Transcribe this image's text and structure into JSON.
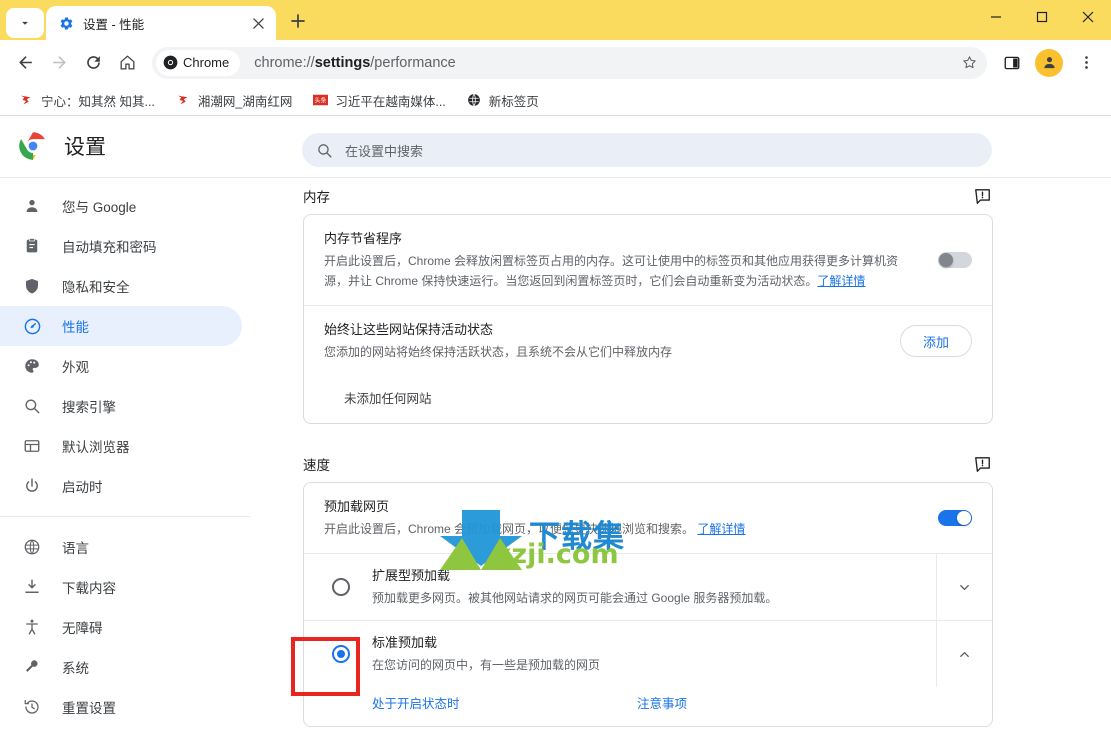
{
  "window": {
    "minimize_label": "—",
    "maximize_label": "□",
    "close_label": "✕"
  },
  "tabstrip": {
    "tab_search_icon": "chevron-down-icon",
    "tabs": [
      {
        "title": "设置 - 性能",
        "favicon": "gear-icon",
        "close_label": "✕"
      }
    ],
    "new_tab_label": "+"
  },
  "toolbar": {
    "back_icon": "back-arrow-icon",
    "forward_icon": "forward-arrow-icon",
    "reload_icon": "reload-icon",
    "home_icon": "home-icon",
    "chrome_chip_label": "Chrome",
    "url_prefix": "chrome://",
    "url_bold": "settings",
    "url_suffix": "/performance",
    "bookmark_icon": "star-icon",
    "sidepanel_icon": "side-panel-icon",
    "profile_icon": "avatar-icon",
    "menu_icon": "three-dot-menu-icon"
  },
  "bookmarks": [
    {
      "label": "宁心：知其然 知其...",
      "icon": "site-favicon-red"
    },
    {
      "label": "湘潮网_湖南红网",
      "icon": "site-favicon-red"
    },
    {
      "label": "习近平在越南媒体...",
      "icon": "toutiao-favicon"
    },
    {
      "label": "新标签页",
      "icon": "globe-dark-icon"
    }
  ],
  "settings_header": {
    "logo_icon": "chrome-logo-icon",
    "title": "设置",
    "search": {
      "icon": "search-icon",
      "placeholder": "在设置中搜索",
      "value": ""
    }
  },
  "sidebar": {
    "items": [
      {
        "label": "您与 Google",
        "icon": "person-icon",
        "active": false
      },
      {
        "label": "自动填充和密码",
        "icon": "clipboard-icon",
        "active": false
      },
      {
        "label": "隐私和安全",
        "icon": "shield-icon",
        "active": false
      },
      {
        "label": "性能",
        "icon": "speedometer-icon",
        "active": true
      },
      {
        "label": "外观",
        "icon": "palette-icon",
        "active": false
      },
      {
        "label": "搜索引擎",
        "icon": "search-icon",
        "active": false
      },
      {
        "label": "默认浏览器",
        "icon": "browser-window-icon",
        "active": false
      },
      {
        "label": "启动时",
        "icon": "power-icon",
        "active": false
      }
    ],
    "items2": [
      {
        "label": "语言",
        "icon": "globe-icon",
        "active": false
      },
      {
        "label": "下载内容",
        "icon": "download-icon",
        "active": false
      },
      {
        "label": "无障碍",
        "icon": "accessibility-icon",
        "active": false
      },
      {
        "label": "系统",
        "icon": "wrench-icon",
        "active": false
      },
      {
        "label": "重置设置",
        "icon": "history-restore-icon",
        "active": false
      }
    ]
  },
  "main": {
    "memory": {
      "section_title": "内存",
      "feedback_icon": "feedback-icon",
      "memory_saver": {
        "title": "内存节省程序",
        "description": "开启此设置后，Chrome 会释放闲置标签页占用的内存。这可让使用中的标签页和其他应用获得更多计算机资源，并让 Chrome 保持快速运行。当您返回到闲置标签页时，它们会自动重新变为活动状态。",
        "learn_more": "了解详情",
        "toggle_state": "off"
      },
      "keep_active": {
        "title": "始终让这些网站保持活动状态",
        "description": "您添加的网站将始终保持活跃状态，且系统不会从它们中释放内存",
        "add_button": "添加",
        "empty_text": "未添加任何网站"
      }
    },
    "speed": {
      "section_title": "速度",
      "feedback_icon": "feedback-icon",
      "preload": {
        "title": "预加载网页",
        "description": "开启此设置后，Chrome 会预加载网页，以便您更快速地浏览和搜索。",
        "learn_more": "了解详情",
        "toggle_state": "on"
      },
      "options": [
        {
          "title": "扩展型预加载",
          "description": "预加载更多网页。被其他网站请求的网页可能会通过 Google 服务器预加载。",
          "selected": false,
          "chevron": "chevron-down-icon"
        },
        {
          "title": "标准预加载",
          "description": "在您访问的网页中，有一些是预加载的网页",
          "selected": true,
          "chevron": "chevron-up-icon"
        }
      ],
      "sub_links": [
        {
          "label": "处于开启状态时"
        },
        {
          "label": "注意事项"
        }
      ]
    }
  },
  "annotation": {
    "color": "#e8251f",
    "target": "standard-preload-radio"
  },
  "watermark": {
    "text": "下载集",
    "url": "xzji.com",
    "blue": "#1f8ad2",
    "green": "#8ec63f"
  }
}
